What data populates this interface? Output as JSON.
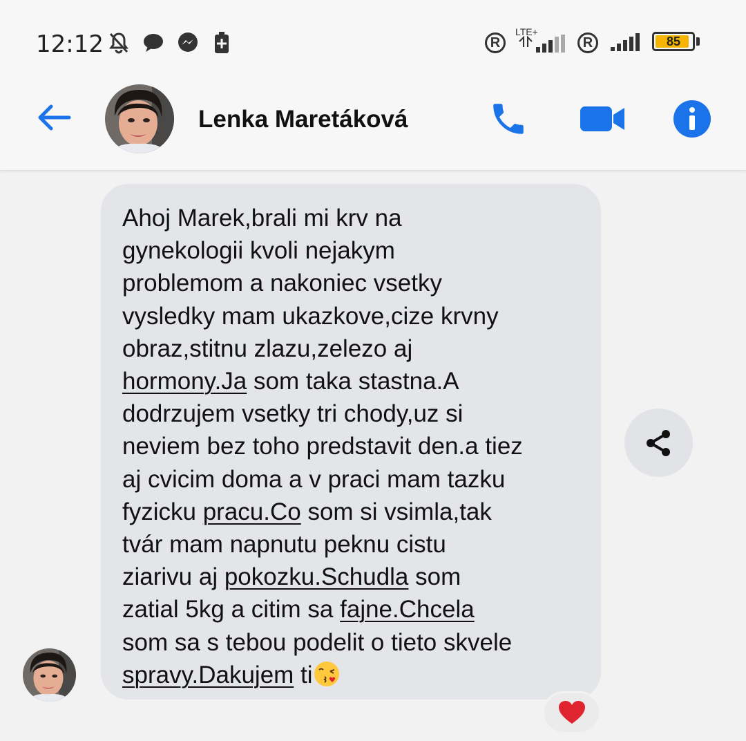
{
  "status_bar": {
    "time": "12:12",
    "network_label": "LTE+",
    "roaming_symbol": "R",
    "battery_level": "85",
    "icons": [
      "mute-icon",
      "chat-bubble-icon",
      "messenger-icon",
      "battery-saver-icon",
      "signal-icon"
    ]
  },
  "header": {
    "contact_name": "Lenka Maretáková",
    "accent_color": "#1a73e8"
  },
  "message": {
    "lines": [
      "Ahoj Marek,brali mi krv na",
      "gynekologii kvoli nejakym",
      "problemom a nakoniec vsetky",
      "vysledky mam ukazkove,cize krvny",
      "obraz,stitnu zlazu,zelezo aj",
      "hormony.Ja",
      " som taka stastna.A",
      "dodrzujem vsetky tri chody,uz si",
      "neviem bez toho predstavit den.a tiez",
      "aj cvicim doma a v praci mam tazku",
      "fyzicku ",
      "pracu.Co",
      " som si vsimla,tak",
      "tvár mam napnutu peknu cistu",
      "ziarivu aj ",
      "pokozku.Schudla",
      " som",
      "zatial 5kg a citim sa ",
      "fajne.Chcela",
      "som sa s tebou podelit o tieto skvele",
      "spravy.Dakujem",
      " ti"
    ],
    "reaction": "heart",
    "reaction_color": "#e0242f"
  }
}
